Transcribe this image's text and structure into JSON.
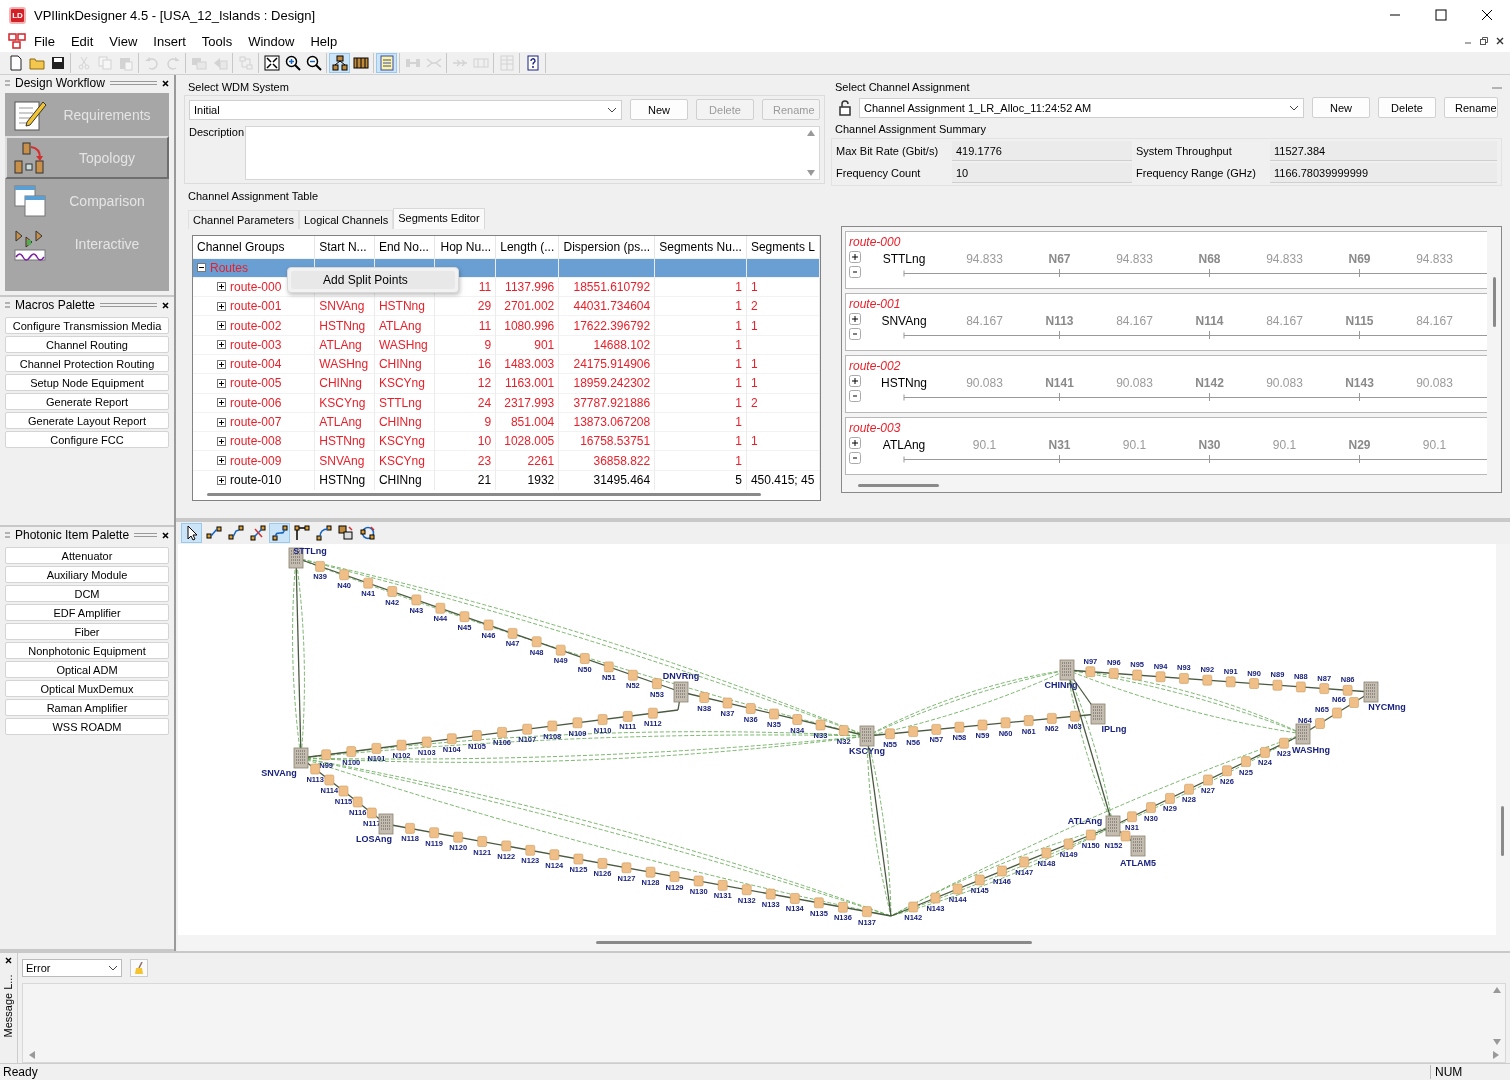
{
  "window": {
    "app_icon": "LD",
    "title": "VPIlinkDesigner 4.5 - [USA_12_Islands : Design]"
  },
  "menu": [
    "File",
    "Edit",
    "View",
    "Insert",
    "Tools",
    "Window",
    "Help"
  ],
  "toolbar": [
    [
      {
        "kind": "new",
        "disabled": false,
        "selected": false
      },
      {
        "kind": "open",
        "disabled": false,
        "selected": false
      },
      {
        "kind": "save",
        "disabled": false,
        "selected": false
      }
    ],
    [
      {
        "kind": "cut",
        "disabled": true,
        "selected": false
      },
      {
        "kind": "copy",
        "disabled": true,
        "selected": false
      },
      {
        "kind": "paste",
        "disabled": true,
        "selected": false
      }
    ],
    [
      {
        "kind": "undo",
        "disabled": true,
        "selected": false
      },
      {
        "kind": "redo",
        "disabled": true,
        "selected": false
      }
    ],
    [
      {
        "kind": "module",
        "disabled": true,
        "selected": false
      },
      {
        "kind": "port",
        "disabled": true,
        "selected": false
      }
    ],
    [
      {
        "kind": "layout",
        "disabled": true,
        "selected": false
      }
    ],
    [
      {
        "kind": "fit",
        "disabled": false,
        "selected": false
      },
      {
        "kind": "zoomin",
        "disabled": false,
        "selected": false
      },
      {
        "kind": "zoomout",
        "disabled": false,
        "selected": false
      }
    ],
    [
      {
        "kind": "topology",
        "disabled": false,
        "selected": true
      },
      {
        "kind": "rack",
        "disabled": false,
        "selected": false
      }
    ],
    [
      {
        "kind": "notes",
        "disabled": false,
        "selected": true
      }
    ],
    [
      {
        "kind": "link",
        "disabled": true,
        "selected": false
      },
      {
        "kind": "split",
        "disabled": true,
        "selected": false
      }
    ],
    [
      {
        "kind": "join",
        "disabled": true,
        "selected": false
      },
      {
        "kind": "box",
        "disabled": true,
        "selected": false
      }
    ],
    [
      {
        "kind": "table",
        "disabled": true,
        "selected": false
      }
    ],
    [
      {
        "kind": "help",
        "disabled": false,
        "selected": false
      }
    ]
  ],
  "design_workflow": {
    "title": "Design Workflow",
    "items": [
      {
        "label": "Requirements",
        "kind": "requirements",
        "selected": false
      },
      {
        "label": "Topology",
        "kind": "topology",
        "selected": true
      },
      {
        "label": "Comparison",
        "kind": "comparison",
        "selected": false
      },
      {
        "label": "Interactive",
        "kind": "interactive",
        "selected": false
      }
    ]
  },
  "macros_palette": {
    "title": "Macros Palette",
    "items": [
      "Configure Transmission Media",
      "Channel Routing",
      "Channel Protection Routing",
      "Setup Node Equipment",
      "Generate Report",
      "Generate Layout Report",
      "Configure FCC"
    ]
  },
  "photonic_palette": {
    "title": "Photonic Item Palette",
    "items": [
      "Attenuator",
      "Auxiliary Module",
      "DCM",
      "EDF Amplifier",
      "Fiber",
      "Nonphotonic Equipment",
      "Optical ADM",
      "Optical MuxDemux",
      "Raman Amplifier",
      "WSS ROADM"
    ]
  },
  "wdm": {
    "label": "Select WDM System",
    "value": "Initial",
    "description_label": "Description",
    "buttons": [
      {
        "label": "New",
        "disabled": false
      },
      {
        "label": "Delete",
        "disabled": true
      },
      {
        "label": "Rename",
        "disabled": true
      }
    ]
  },
  "assignment": {
    "label": "Select Channel Assignment",
    "locked": false,
    "value": "Channel Assignment 1_LR_Alloc_11:24:52 AM",
    "buttons": [
      {
        "label": "New",
        "disabled": false
      },
      {
        "label": "Delete",
        "disabled": false
      },
      {
        "label": "Rename",
        "disabled": false
      }
    ]
  },
  "summary": {
    "title": "Channel Assignment Summary",
    "fields": [
      {
        "label": "Max Bit Rate (Gbit/s)",
        "value": "419.1776"
      },
      {
        "label": "System Throughput",
        "value": "11527.384"
      },
      {
        "label": "Frequency Count",
        "value": "10"
      },
      {
        "label": "Frequency Range (GHz)",
        "value": "1166.78039999999"
      }
    ]
  },
  "table_group": {
    "title": "Channel Assignment Table",
    "tabs": [
      {
        "label": "Channel Parameters",
        "selected": false
      },
      {
        "label": "Logical Channels",
        "selected": false
      },
      {
        "label": "Segments Editor",
        "selected": true
      }
    ]
  },
  "table": {
    "columns": [
      "Channel Groups",
      "Start N...",
      "End No...",
      "Hop Nu...",
      "Length (...",
      "Dispersion (ps...",
      "Segments Nu...",
      "Segments L"
    ],
    "group": {
      "label": "Routes",
      "expanded": true,
      "selected": true,
      "color": "#e8202a"
    },
    "rows": [
      {
        "name": "route-000",
        "hops": "11",
        "length": "1137.996",
        "dispersion": "18551.610792",
        "segments": "1",
        "segment_lengths": "1",
        "color": "#e8202a",
        "expanded": false
      },
      {
        "name": "route-001",
        "start": "SNVAng",
        "end": "HSTNng",
        "hops": "29",
        "length": "2701.002",
        "dispersion": "44031.734604",
        "segments": "1",
        "segment_lengths": "2",
        "color": "#e8202a",
        "expanded": false
      },
      {
        "name": "route-002",
        "start": "HSTNng",
        "end": "ATLAng",
        "hops": "11",
        "length": "1080.996",
        "dispersion": "17622.396792",
        "segments": "1",
        "segment_lengths": "1",
        "color": "#e8202a",
        "expanded": false
      },
      {
        "name": "route-003",
        "start": "ATLAng",
        "end": "WASHng",
        "hops": "9",
        "length": "901",
        "dispersion": "14688.102",
        "segments": "1",
        "color": "#e8202a",
        "expanded": false
      },
      {
        "name": "route-004",
        "start": "WASHng",
        "end": "CHINng",
        "hops": "16",
        "length": "1483.003",
        "dispersion": "24175.914906",
        "segments": "1",
        "segment_lengths": "1",
        "color": "#e8202a",
        "expanded": false
      },
      {
        "name": "route-005",
        "start": "CHINng",
        "end": "KSCYng",
        "hops": "12",
        "length": "1163.001",
        "dispersion": "18959.242302",
        "segments": "1",
        "segment_lengths": "1",
        "color": "#e8202a",
        "expanded": false
      },
      {
        "name": "route-006",
        "start": "KSCYng",
        "end": "STTLng",
        "hops": "24",
        "length": "2317.993",
        "dispersion": "37787.921886",
        "segments": "1",
        "segment_lengths": "2",
        "color": "#e8202a",
        "expanded": false
      },
      {
        "name": "route-007",
        "start": "ATLAng",
        "end": "CHINng",
        "hops": "9",
        "length": "851.004",
        "dispersion": "13873.067208",
        "segments": "1",
        "color": "#e8202a",
        "expanded": false
      },
      {
        "name": "route-008",
        "start": "HSTNng",
        "end": "KSCYng",
        "hops": "10",
        "length": "1028.005",
        "dispersion": "16758.53751",
        "segments": "1",
        "segment_lengths": "1",
        "color": "#e8202a",
        "expanded": false
      },
      {
        "name": "route-009",
        "start": "SNVAng",
        "end": "KSCYng",
        "hops": "23",
        "length": "2261",
        "dispersion": "36858.822",
        "segments": "1",
        "color": "#e8202a",
        "expanded": false
      },
      {
        "name": "route-010",
        "start": "HSTNng",
        "end": "CHINng",
        "hops": "21",
        "length": "1932",
        "dispersion": "31495.464",
        "segments": "5",
        "segment_lengths": "450.415; 45",
        "color": "#000000",
        "expanded": false
      }
    ]
  },
  "context_menu": {
    "items": [
      "Add Split Points"
    ]
  },
  "segments_editor": {
    "routes": [
      {
        "name": "route-000",
        "start": "STTLng",
        "segments": [
          {
            "kind": "length",
            "text": "94.833"
          },
          {
            "kind": "node",
            "text": "N67"
          },
          {
            "kind": "length",
            "text": "94.833"
          },
          {
            "kind": "node",
            "text": "N68"
          },
          {
            "kind": "length",
            "text": "94.833"
          },
          {
            "kind": "node",
            "text": "N69"
          },
          {
            "kind": "length",
            "text": "94.833"
          }
        ]
      },
      {
        "name": "route-001",
        "start": "SNVAng",
        "segments": [
          {
            "kind": "length",
            "text": "84.167"
          },
          {
            "kind": "node",
            "text": "N113"
          },
          {
            "kind": "length",
            "text": "84.167"
          },
          {
            "kind": "node",
            "text": "N114"
          },
          {
            "kind": "length",
            "text": "84.167"
          },
          {
            "kind": "node",
            "text": "N115"
          },
          {
            "kind": "length",
            "text": "84.167"
          }
        ]
      },
      {
        "name": "route-002",
        "start": "HSTNng",
        "segments": [
          {
            "kind": "length",
            "text": "90.083"
          },
          {
            "kind": "node",
            "text": "N141"
          },
          {
            "kind": "length",
            "text": "90.083"
          },
          {
            "kind": "node",
            "text": "N142"
          },
          {
            "kind": "length",
            "text": "90.083"
          },
          {
            "kind": "node",
            "text": "N143"
          },
          {
            "kind": "length",
            "text": "90.083"
          }
        ]
      },
      {
        "name": "route-003",
        "start": "ATLAng",
        "segments": [
          {
            "kind": "length",
            "text": "90.1"
          },
          {
            "kind": "node",
            "text": "N31"
          },
          {
            "kind": "length",
            "text": "90.1"
          },
          {
            "kind": "node",
            "text": "N30"
          },
          {
            "kind": "length",
            "text": "90.1"
          },
          {
            "kind": "node",
            "text": "N29"
          },
          {
            "kind": "length",
            "text": "90.1"
          }
        ]
      }
    ]
  },
  "canvas_tools": [
    {
      "kind": "pointer",
      "selected": true
    },
    {
      "kind": "connect",
      "selected": false
    },
    {
      "kind": "connect2",
      "selected": false
    },
    {
      "kind": "cross",
      "selected": false
    },
    {
      "kind": "curve",
      "selected": true
    },
    {
      "kind": "orthogonal",
      "selected": false
    },
    {
      "kind": "curve2",
      "selected": false
    },
    {
      "kind": "group",
      "selected": false
    },
    {
      "kind": "cycle",
      "selected": false
    }
  ],
  "network": {
    "sites": [
      {
        "name": "STTLng"
      },
      {
        "name": "SNVAng"
      },
      {
        "name": "LOSAng"
      },
      {
        "name": "DNVRng"
      },
      {
        "name": "KSCYng"
      },
      {
        "name": "CHINng"
      },
      {
        "name": "IPLng"
      },
      {
        "name": "NYCMng"
      },
      {
        "name": "WASHng"
      },
      {
        "name": "ATLAng"
      },
      {
        "name": "ATLAM5"
      }
    ],
    "spans": [
      {
        "amplifiers": [
          "N39",
          "N40",
          "N41",
          "N42",
          "N43",
          "N44",
          "N45",
          "N46",
          "N47",
          "N48",
          "N49",
          "N50",
          "N51",
          "N52",
          "N53"
        ]
      },
      {
        "amplifiers": [
          "N99",
          "N100",
          "N101",
          "N102",
          "N103",
          "N104",
          "N105",
          "N106",
          "N107",
          "N108",
          "N109",
          "N110",
          "N111",
          "N112"
        ]
      },
      {
        "amplifiers": [
          "N113",
          "N114",
          "N115",
          "N116",
          "N117"
        ]
      },
      {
        "amplifiers": [
          "N118",
          "N119",
          "N120",
          "N121",
          "N122",
          "N123",
          "N124",
          "N125",
          "N126",
          "N127",
          "N128",
          "N129",
          "N130",
          "N131",
          "N132",
          "N133",
          "N134",
          "N135",
          "N136",
          "N137"
        ]
      },
      {
        "amplifiers": [
          "N38",
          "N37",
          "N36",
          "N35",
          "N34",
          "N33",
          "N32"
        ]
      },
      {
        "amplifiers": [
          "N55",
          "N56",
          "N57",
          "N58",
          "N59",
          "N60",
          "N61",
          "N62",
          "N63"
        ]
      },
      {
        "amplifiers": [
          "N150",
          "N149",
          "N148",
          "N147",
          "N146",
          "N145",
          "N144",
          "N143",
          "N142"
        ]
      },
      {
        "amplifiers": [
          "N97",
          "N96",
          "N95",
          "N94",
          "N93",
          "N92",
          "N91",
          "N90",
          "N89",
          "N88",
          "N87",
          "N86"
        ]
      },
      {
        "amplifiers": [
          "N23",
          "N24",
          "N25",
          "N26",
          "N27",
          "N28",
          "N29",
          "N30",
          "N31"
        ]
      },
      {
        "amplifiers": [
          "N152"
        ]
      },
      {
        "amplifiers": [
          "N66",
          "N65",
          "N64"
        ]
      }
    ]
  },
  "messages": {
    "tab": "Message L...",
    "filter": "Error"
  },
  "status_bar": {
    "text": "Ready",
    "indicators": [
      "NUM"
    ]
  }
}
